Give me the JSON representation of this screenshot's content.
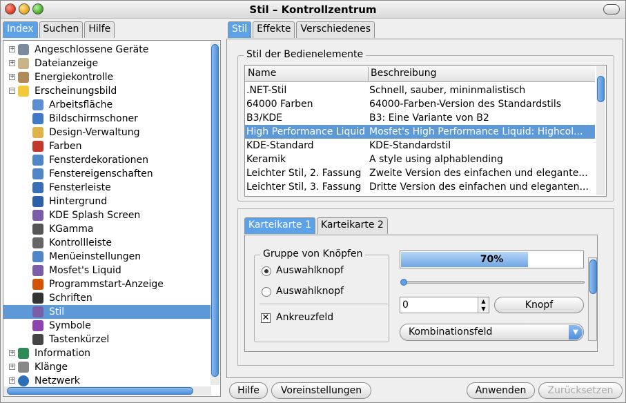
{
  "window": {
    "title": "Stil – Kontrollzentrum"
  },
  "left_tabs": [
    "Index",
    "Suchen",
    "Hilfe"
  ],
  "tree": [
    {
      "label": "Angeschlossene Geräte",
      "level": 0,
      "expander": "+",
      "icon": "hardware-icon"
    },
    {
      "label": "Dateianzeige",
      "level": 0,
      "expander": "+",
      "icon": "file-browsing-icon"
    },
    {
      "label": "Energiekontrolle",
      "level": 0,
      "expander": "+",
      "icon": "power-icon"
    },
    {
      "label": "Erscheinungsbild",
      "level": 0,
      "expander": "-",
      "icon": "appearance-star-icon"
    },
    {
      "label": "Arbeitsfläche",
      "level": 1,
      "icon": "desktop-brush-icon"
    },
    {
      "label": "Bildschirmschoner",
      "level": 1,
      "icon": "screensaver-icon"
    },
    {
      "label": "Design-Verwaltung",
      "level": 1,
      "icon": "theme-cube-icon"
    },
    {
      "label": "Farben",
      "level": 1,
      "icon": "colors-icon"
    },
    {
      "label": "Fensterdekorationen",
      "level": 1,
      "icon": "window-decoration-icon"
    },
    {
      "label": "Fenstereigenschaften",
      "level": 1,
      "icon": "window-behavior-icon"
    },
    {
      "label": "Fensterleiste",
      "level": 1,
      "icon": "taskbar-gear-icon"
    },
    {
      "label": "Hintergrund",
      "level": 1,
      "icon": "background-icon"
    },
    {
      "label": "KDE Splash Screen",
      "level": 1,
      "icon": "splash-screen-icon"
    },
    {
      "label": "KGamma",
      "level": 1,
      "icon": "gamma-icon"
    },
    {
      "label": "Kontrollleiste",
      "level": 1,
      "icon": "panel-icon"
    },
    {
      "label": "Menüeinstellungen",
      "level": 1,
      "icon": "menu-icon"
    },
    {
      "label": "Mosfet's Liquid",
      "level": 1,
      "icon": "liquid-icon"
    },
    {
      "label": "Programmstart-Anzeige",
      "level": 1,
      "icon": "launch-rocket-icon"
    },
    {
      "label": "Schriften",
      "level": 1,
      "icon": "fonts-icon"
    },
    {
      "label": "Stil",
      "level": 1,
      "icon": "style-icon",
      "selected": true
    },
    {
      "label": "Symbole",
      "level": 1,
      "icon": "icons-icon"
    },
    {
      "label": "Tastenkürzel",
      "level": 1,
      "icon": "shortcuts-icon"
    },
    {
      "label": "Information",
      "level": 0,
      "expander": "+",
      "icon": "information-icon"
    },
    {
      "label": "Klänge",
      "level": 0,
      "expander": "+",
      "icon": "sound-icon"
    },
    {
      "label": "Netzwerk",
      "level": 0,
      "expander": "+",
      "icon": "network-globe-icon"
    }
  ],
  "right_tabs": [
    "Stil",
    "Effekte",
    "Verschiedenes"
  ],
  "style_group": {
    "label": "Stil der Bedienelemente",
    "columns": [
      "Name",
      "Beschreibung"
    ],
    "rows": [
      {
        "name": ".NET-Stil",
        "desc": "Schnell, sauber, mininmalistisch"
      },
      {
        "name": "64000 Farben",
        "desc": "64000-Farben-Version des Standardstils"
      },
      {
        "name": "B3/KDE",
        "desc": "B3: Eine Variante von B2"
      },
      {
        "name": "High Performance Liquid",
        "desc": "Mosfet's High Performance Liquid: Highcol...",
        "selected": true
      },
      {
        "name": "KDE-Standard",
        "desc": "KDE-Standardstil"
      },
      {
        "name": "Keramik",
        "desc": "A style using alphablending"
      },
      {
        "name": "Leichter Stil, 2. Fassung",
        "desc": "Zweite Version des einfachen und elegante..."
      },
      {
        "name": "Leichter Stil, 3. Fassung",
        "desc": "Dritte Version des einfachen und eleganten..."
      }
    ]
  },
  "preview": {
    "tabs": [
      "Karteikarte 1",
      "Karteikarte 2"
    ],
    "radio_group_label": "Gruppe von Knöpfen",
    "radio1": "Auswahlknopf",
    "radio2": "Auswahlknopf",
    "checkbox": "Ankreuzfeld",
    "progress_text": "70%",
    "progress_value": 0.7,
    "spin_value": "0",
    "button": "Knopf",
    "combo": "Kombinationsfeld"
  },
  "bottom_buttons": {
    "help": "Hilfe",
    "defaults": "Voreinstellungen",
    "apply": "Anwenden",
    "reset": "Zurücksetzen"
  },
  "colors": {
    "accent": "#5da1e6",
    "selection": "#5c99d6"
  }
}
